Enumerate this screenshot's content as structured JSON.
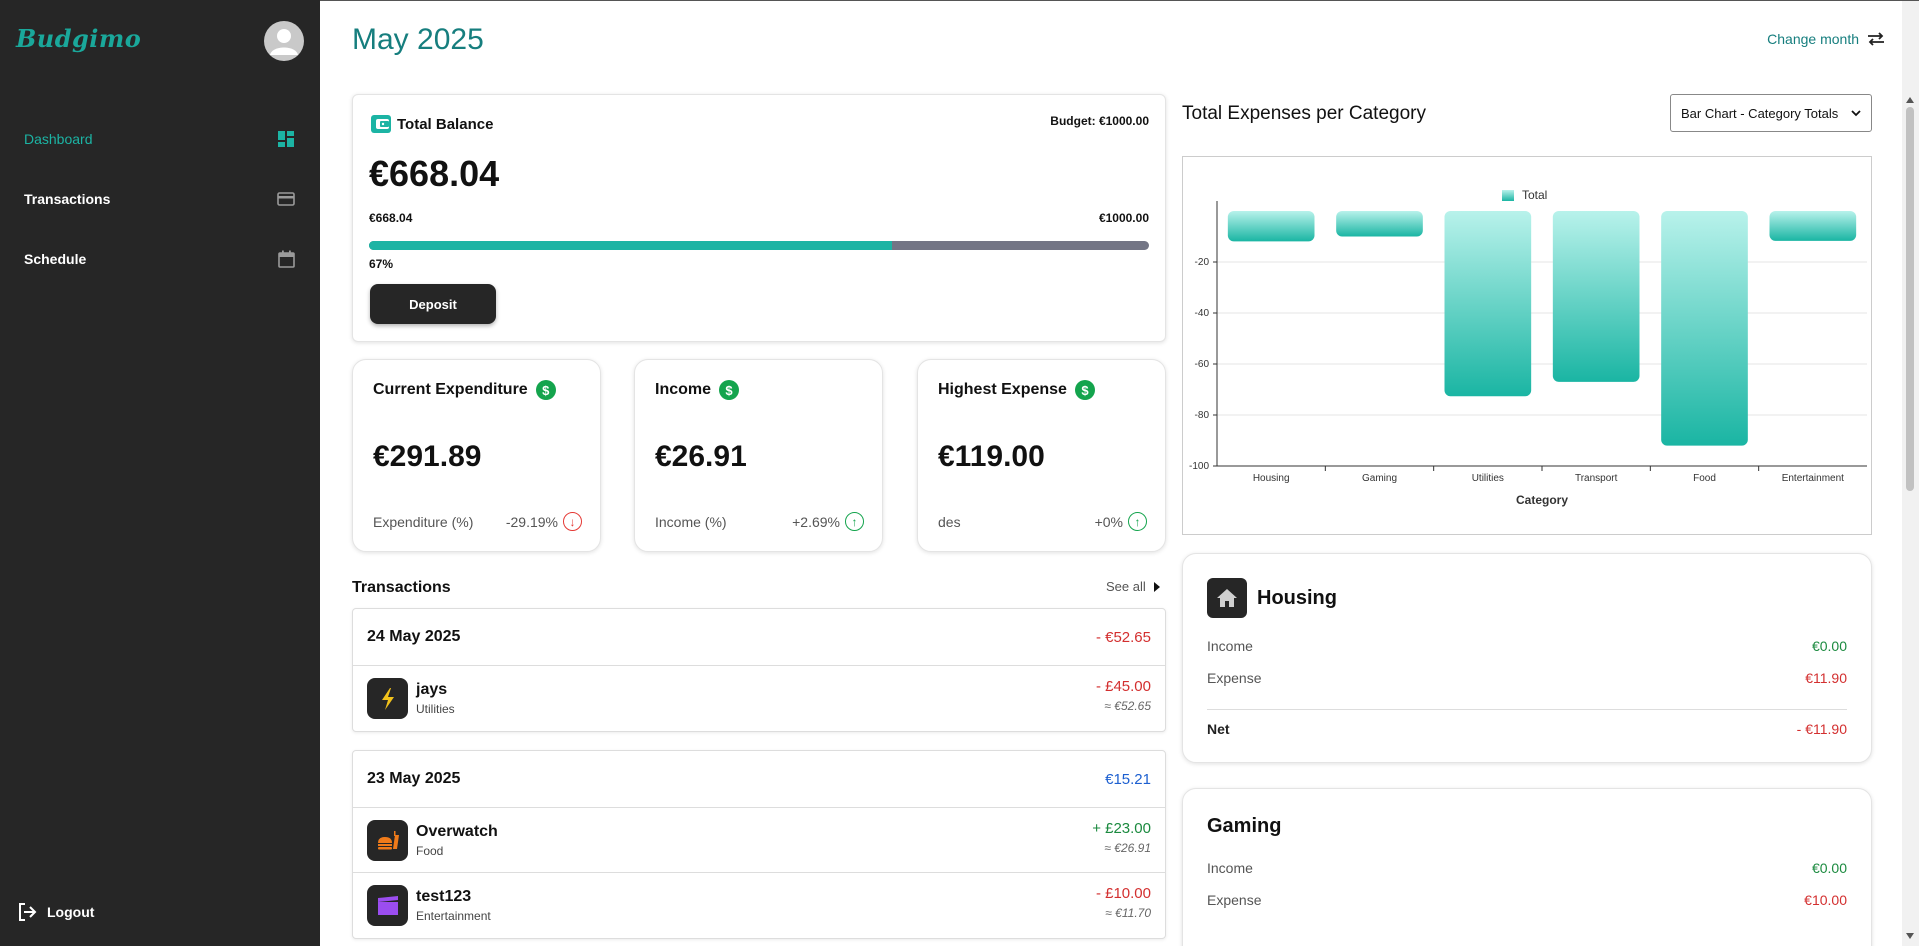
{
  "sidebar": {
    "logo": "Budgimo",
    "nav": [
      {
        "label": "Dashboard",
        "icon": "dashboard-icon"
      },
      {
        "label": "Transactions",
        "icon": "credit-card-icon"
      },
      {
        "label": "Schedule",
        "icon": "calendar-icon"
      }
    ],
    "logout": "Logout"
  },
  "header": {
    "title": "May 2025",
    "change_month": "Change month"
  },
  "balance": {
    "title": "Total Balance",
    "budget_label": "Budget: €1000.00",
    "amount": "€668.04",
    "current": "€668.04",
    "max": "€1000.00",
    "percent_label": "67%",
    "progress": 0.67,
    "deposit_label": "Deposit"
  },
  "stats": [
    {
      "title": "Current Expenditure",
      "value": "€291.89",
      "foot_label": "Expenditure (%)",
      "change": "-29.19%",
      "direction": "down"
    },
    {
      "title": "Income",
      "value": "€26.91",
      "foot_label": "Income (%)",
      "change": "+2.69%",
      "direction": "up"
    },
    {
      "title": "Highest Expense",
      "value": "€119.00",
      "foot_label": "des",
      "change": "+0%",
      "direction": "up"
    }
  ],
  "transactions": {
    "heading": "Transactions",
    "see_all": "See all",
    "groups": [
      {
        "date": "24 May 2025",
        "total": "- €52.65",
        "items": [
          {
            "name": "jays",
            "category": "Utilities",
            "amount": "- £45.00",
            "converted": "≈ €52.65",
            "icon": "lightning-icon"
          }
        ]
      },
      {
        "date": "23 May 2025",
        "total": "€15.21",
        "items": [
          {
            "name": "Overwatch",
            "category": "Food",
            "amount": "+ £23.00",
            "converted": "≈ €26.91",
            "icon": "fastfood-icon"
          },
          {
            "name": "test123",
            "category": "Entertainment",
            "amount": "- £10.00",
            "converted": "≈ €11.70",
            "icon": "clapperboard-icon"
          }
        ]
      }
    ]
  },
  "chart_panel": {
    "title": "Total Expenses per Category",
    "select_value": "Bar Chart - Category Totals"
  },
  "chart_data": {
    "type": "bar",
    "categories": [
      "Housing",
      "Gaming",
      "Utilities",
      "Transport",
      "Food",
      "Entertainment"
    ],
    "series": [
      {
        "name": "Total",
        "values": [
          -11.9,
          -10.0,
          -72.65,
          -67.0,
          -92.0,
          -11.7
        ]
      }
    ],
    "xlabel": "Category",
    "ylabel": "",
    "ylim": [
      -100,
      0
    ],
    "yticks": [
      "-20",
      "-40",
      "-60",
      "-80",
      "-100"
    ],
    "grid": true,
    "legend": "top-center",
    "colors": {
      "bar_top": "#b8f2eb",
      "bar_bottom": "#1ab5a3"
    }
  },
  "categories_cards": [
    {
      "name": "Housing",
      "icon": "home-icon",
      "income_label": "Income",
      "income": "€0.00",
      "expense_label": "Expense",
      "expense": "€11.90",
      "net_label": "Net",
      "net": "- €11.90"
    },
    {
      "name": "Gaming",
      "icon": "",
      "income_label": "Income",
      "income": "€0.00",
      "expense_label": "Expense",
      "expense": "€10.00"
    }
  ],
  "colors": {
    "accent": "#1cb4a4",
    "sidebar": "#262626",
    "negative": "#d32f2f",
    "positive": "#1b8a3f"
  }
}
